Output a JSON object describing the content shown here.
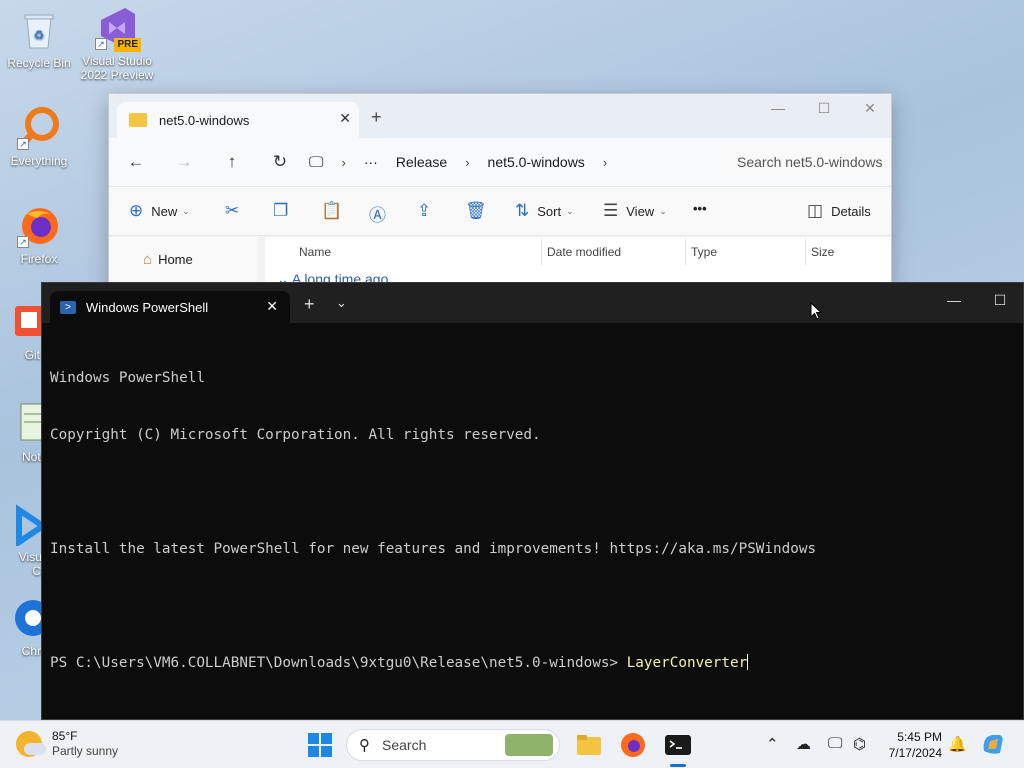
{
  "desktop": {
    "icons": [
      {
        "label": "Recycle Bin",
        "icon": "recycle-bin-icon"
      },
      {
        "label": "Visual Studio 2022 Preview",
        "icon": "visual-studio-icon",
        "badge": "PRE"
      },
      {
        "label": "Everything",
        "icon": "everything-search-icon"
      },
      {
        "label": "Firefox",
        "icon": "firefox-icon"
      },
      {
        "label": "Git B",
        "icon": "git-bash-icon"
      },
      {
        "label": "Notep",
        "icon": "notepad-icon"
      },
      {
        "label": "Visual",
        "label2": "Co",
        "icon": "vscode-icon"
      },
      {
        "label": "Chron",
        "icon": "chrome-icon"
      }
    ]
  },
  "explorer": {
    "tab_title": "net5.0-windows",
    "breadcrumb": [
      "Release",
      "net5.0-windows"
    ],
    "breadcrumb_more": "···",
    "search_placeholder": "Search net5.0-windows",
    "toolbar": {
      "new_label": "New",
      "sort_label": "Sort",
      "view_label": "View",
      "more_label": "•••",
      "details_label": "Details"
    },
    "sidebar": {
      "home_label": "Home"
    },
    "columns": [
      "Name",
      "Date modified",
      "Type",
      "Size"
    ],
    "group_label": "A long time ago"
  },
  "terminal": {
    "tab_title": "Windows PowerShell",
    "lines": [
      "Windows PowerShell",
      "Copyright (C) Microsoft Corporation. All rights reserved.",
      "",
      "Install the latest PowerShell for new features and improvements! https://aka.ms/PSWindows",
      ""
    ],
    "prompt": "PS C:\\Users\\VM6.COLLABNET\\Downloads\\9xtgu0\\Release\\net5.0-windows> ",
    "command": "LayerConverter"
  },
  "taskbar": {
    "weather_temp": "85°F",
    "weather_desc": "Partly sunny",
    "search_label": "Search",
    "time": "5:45 PM",
    "date": "7/17/2024",
    "accent_color": "#1a6fd1"
  }
}
